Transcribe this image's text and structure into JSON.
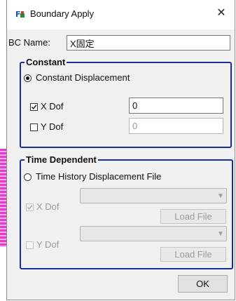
{
  "window": {
    "title": "Boundary Apply",
    "close_glyph": "✕"
  },
  "bc_name": {
    "label": "BC Name:",
    "value": "X固定"
  },
  "constant": {
    "legend": "Constant",
    "radio_label": "Constant Displacement",
    "radio_checked": true,
    "x_dof": {
      "label": "X Dof",
      "checked": true,
      "value": "0"
    },
    "y_dof": {
      "label": "Y Dof",
      "checked": false,
      "value": "0"
    }
  },
  "time_dependent": {
    "legend": "Time Dependent",
    "radio_label": "Time History Displacement File",
    "radio_checked": false,
    "x_dof": {
      "label": "X Dof",
      "checked": true,
      "load_label": "Load File"
    },
    "y_dof": {
      "label": "Y Dof",
      "checked": false,
      "load_label": "Load File"
    }
  },
  "ok_label": "OK",
  "colors": {
    "group_border": "#1a2d9e",
    "dialog_bg": "#f0f0f0",
    "side_strip": "#e040c8"
  }
}
